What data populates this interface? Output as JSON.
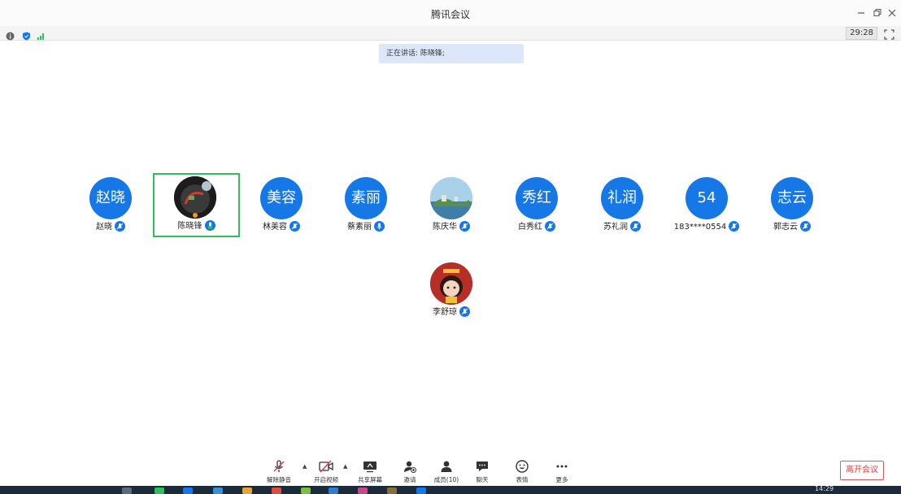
{
  "window": {
    "title": "腾讯会议",
    "minimize_icon": "minimize-icon",
    "restore_icon": "restore-icon",
    "close_icon": "close-icon"
  },
  "statusbar": {
    "icons": [
      "info-icon",
      "shield-icon",
      "signal-icon"
    ],
    "timer": "29:28",
    "fullscreen_icon": "fullscreen-icon"
  },
  "speaking": {
    "text": "正在讲话: 陈晓锋;"
  },
  "participants": [
    {
      "avatar_text": "赵晓",
      "name": "赵晓",
      "active": false
    },
    {
      "avatar_text": "",
      "name": "陈晓锋",
      "active": true
    },
    {
      "avatar_text": "美容",
      "name": "林美容",
      "active": false
    },
    {
      "avatar_text": "素丽",
      "name": "蔡素丽",
      "active": false
    },
    {
      "avatar_text": "",
      "name": "陈庆华",
      "active": false
    },
    {
      "avatar_text": "秀红",
      "name": "白秀红",
      "active": false
    },
    {
      "avatar_text": "礼润",
      "name": "苏礼润",
      "active": false
    },
    {
      "avatar_text": "54",
      "name": "183****0554",
      "active": false
    },
    {
      "avatar_text": "志云",
      "name": "郭志云",
      "active": false
    },
    {
      "avatar_text": "",
      "name": "李舒琼",
      "active": false
    }
  ],
  "toolbar": {
    "unmute": "解除静音",
    "video": "开启视频",
    "share": "共享屏幕",
    "invite": "邀请",
    "members": "成员(10)",
    "chat": "聊天",
    "reactions": "表情",
    "more": "更多",
    "leave": "离开会议"
  },
  "taskbar": {
    "clock": "14:29"
  },
  "colors": {
    "accent": "#1677e6",
    "active_border": "#2ec15a",
    "leave": "#e03f3f",
    "banner": "#dce8fa"
  }
}
